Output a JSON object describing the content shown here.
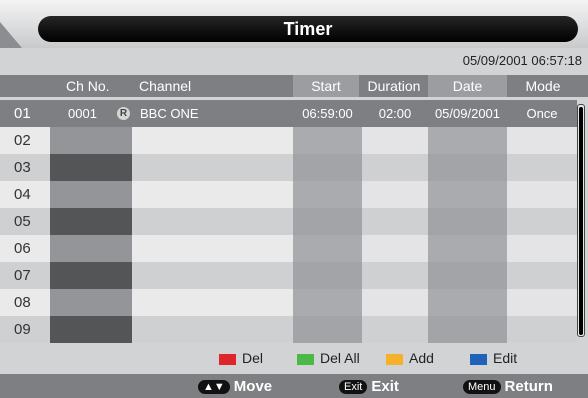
{
  "title": "Timer",
  "datetime": "05/09/2001 06:57:18",
  "columns": {
    "ch_no": "Ch No.",
    "channel": "Channel",
    "start": "Start",
    "duration": "Duration",
    "date": "Date",
    "mode": "Mode"
  },
  "rows": [
    {
      "index": "01",
      "ch_no": "0001",
      "badge": "R",
      "channel": "BBC ONE",
      "start": "06:59:00",
      "duration": "02:00",
      "date": "05/09/2001",
      "mode": "Once"
    },
    {
      "index": "02"
    },
    {
      "index": "03"
    },
    {
      "index": "04"
    },
    {
      "index": "05"
    },
    {
      "index": "06"
    },
    {
      "index": "07"
    },
    {
      "index": "08"
    },
    {
      "index": "09"
    }
  ],
  "legend": {
    "del": {
      "label": "Del",
      "color": "#e0242b"
    },
    "del_all": {
      "label": "Del All",
      "color": "#4cb848"
    },
    "add": {
      "label": "Add",
      "color": "#f6b12a"
    },
    "edit": {
      "label": "Edit",
      "color": "#1f62b8"
    }
  },
  "footer": {
    "move": {
      "key": "▲▼",
      "label": "Move"
    },
    "exit": {
      "key": "Exit",
      "label": "Exit"
    },
    "return": {
      "key": "Menu",
      "label": "Return"
    }
  }
}
